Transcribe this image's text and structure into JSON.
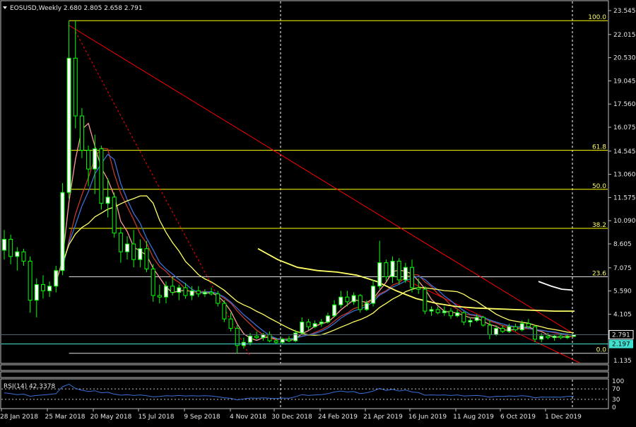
{
  "window": {
    "symbol_line": "EOSUSD,Weekly  2.680 2.805 2.658 2.791",
    "menu_icon": "triangle-down-icon"
  },
  "colors": {
    "background": "#000000",
    "bull_candle": "#ffffff",
    "bear_candle": "#ffffff",
    "candle_outline": "#00ff00",
    "fib_line": "#ffff00",
    "trend_line": "#ff0000",
    "ma_fast": "#ff9999",
    "ma_mid": "#c0392b",
    "ma_blue": "#3a6fd8",
    "ma_yellow": "#ffff66",
    "ma_white": "#ffffff",
    "current_price_box": "#ffffff",
    "bid_box": "#40e0d0",
    "rsi_line": "#3a6fd8"
  },
  "chart_data": {
    "type": "candlestick",
    "title": "EOSUSD,Weekly",
    "ohlc_label": "2.680 2.805 2.658 2.791",
    "ylim": [
      1.135,
      23.545
    ],
    "y_ticks": [
      "23.545",
      "22.015",
      "20.530",
      "19.045",
      "17.560",
      "16.075",
      "14.545",
      "13.060",
      "11.575",
      "10.090",
      "8.605",
      "7.075",
      "5.590",
      "4.105",
      "2.791",
      "2.197",
      "1.135"
    ],
    "x_tick_labels": [
      "28 Jan 2018",
      "25 Mar 2018",
      "20 May 2018",
      "15 Jul 2018",
      "9 Sep 2018",
      "4 Nov 2018",
      "30 Dec 2018",
      "24 Feb 2019",
      "21 Apr 2019",
      "16 Jun 2019",
      "11 Aug 2019",
      "6 Oct 2019",
      "1 Dec 2019"
    ],
    "fib_levels": [
      {
        "label": "100.0",
        "value": 22.9
      },
      {
        "label": "61.8",
        "value": 14.6
      },
      {
        "label": "50.0",
        "value": 12.1
      },
      {
        "label": "38.2",
        "value": 9.6
      },
      {
        "label": "23.6",
        "value": 6.5
      },
      {
        "label": "0.0",
        "value": 1.6
      }
    ],
    "current_price": "2.791",
    "bid_price": "2.197",
    "candles": [
      {
        "o": 8.2,
        "h": 9.5,
        "l": 7.6,
        "c": 8.9
      },
      {
        "o": 8.9,
        "h": 9.2,
        "l": 7.3,
        "c": 7.8
      },
      {
        "o": 7.8,
        "h": 8.4,
        "l": 6.9,
        "c": 8.1
      },
      {
        "o": 8.1,
        "h": 8.3,
        "l": 7.2,
        "c": 7.5
      },
      {
        "o": 7.5,
        "h": 7.8,
        "l": 4.2,
        "c": 5.0
      },
      {
        "o": 5.0,
        "h": 6.4,
        "l": 3.9,
        "c": 6.0
      },
      {
        "o": 6.0,
        "h": 6.6,
        "l": 5.1,
        "c": 5.6
      },
      {
        "o": 5.6,
        "h": 6.2,
        "l": 5.2,
        "c": 5.9
      },
      {
        "o": 5.9,
        "h": 7.2,
        "l": 5.5,
        "c": 6.9
      },
      {
        "o": 6.9,
        "h": 12.5,
        "l": 6.6,
        "c": 11.9
      },
      {
        "o": 11.9,
        "h": 22.9,
        "l": 11.5,
        "c": 20.5
      },
      {
        "o": 20.5,
        "h": 22.9,
        "l": 16.0,
        "c": 16.8
      },
      {
        "o": 16.8,
        "h": 17.3,
        "l": 14.1,
        "c": 14.6
      },
      {
        "o": 14.6,
        "h": 14.9,
        "l": 12.3,
        "c": 13.4
      },
      {
        "o": 13.4,
        "h": 15.6,
        "l": 11.8,
        "c": 14.7
      },
      {
        "o": 14.7,
        "h": 14.9,
        "l": 10.8,
        "c": 11.2
      },
      {
        "o": 11.2,
        "h": 12.8,
        "l": 10.3,
        "c": 11.6
      },
      {
        "o": 11.6,
        "h": 11.9,
        "l": 9.0,
        "c": 9.3
      },
      {
        "o": 9.3,
        "h": 9.7,
        "l": 7.4,
        "c": 8.1
      },
      {
        "o": 8.1,
        "h": 9.1,
        "l": 7.6,
        "c": 8.6
      },
      {
        "o": 8.6,
        "h": 9.5,
        "l": 7.1,
        "c": 7.6
      },
      {
        "o": 7.6,
        "h": 8.9,
        "l": 7.1,
        "c": 8.3
      },
      {
        "o": 8.3,
        "h": 8.8,
        "l": 6.8,
        "c": 7.0
      },
      {
        "o": 7.0,
        "h": 7.3,
        "l": 4.9,
        "c": 5.3
      },
      {
        "o": 5.3,
        "h": 6.0,
        "l": 4.8,
        "c": 5.2
      },
      {
        "o": 5.2,
        "h": 6.2,
        "l": 4.8,
        "c": 5.9
      },
      {
        "o": 5.9,
        "h": 6.5,
        "l": 5.3,
        "c": 5.5
      },
      {
        "o": 5.5,
        "h": 6.0,
        "l": 5.0,
        "c": 5.8
      },
      {
        "o": 5.8,
        "h": 6.1,
        "l": 5.1,
        "c": 5.3
      },
      {
        "o": 5.3,
        "h": 5.9,
        "l": 5.0,
        "c": 5.6
      },
      {
        "o": 5.6,
        "h": 5.9,
        "l": 5.2,
        "c": 5.4
      },
      {
        "o": 5.4,
        "h": 5.7,
        "l": 5.2,
        "c": 5.5
      },
      {
        "o": 5.5,
        "h": 5.8,
        "l": 5.3,
        "c": 5.4
      },
      {
        "o": 5.4,
        "h": 5.6,
        "l": 4.6,
        "c": 4.8
      },
      {
        "o": 4.8,
        "h": 5.0,
        "l": 3.6,
        "c": 3.8
      },
      {
        "o": 3.8,
        "h": 4.2,
        "l": 3.0,
        "c": 3.2
      },
      {
        "o": 3.2,
        "h": 3.4,
        "l": 1.6,
        "c": 2.1
      },
      {
        "o": 2.1,
        "h": 2.6,
        "l": 1.9,
        "c": 2.3
      },
      {
        "o": 2.3,
        "h": 2.9,
        "l": 2.1,
        "c": 2.7
      },
      {
        "o": 2.7,
        "h": 3.0,
        "l": 2.5,
        "c": 2.6
      },
      {
        "o": 2.6,
        "h": 2.9,
        "l": 2.4,
        "c": 2.8
      },
      {
        "o": 2.8,
        "h": 3.0,
        "l": 2.3,
        "c": 2.4
      },
      {
        "o": 2.4,
        "h": 2.6,
        "l": 2.2,
        "c": 2.3
      },
      {
        "o": 2.3,
        "h": 2.6,
        "l": 2.2,
        "c": 2.5
      },
      {
        "o": 2.5,
        "h": 2.7,
        "l": 2.3,
        "c": 2.4
      },
      {
        "o": 2.4,
        "h": 3.1,
        "l": 2.3,
        "c": 2.9
      },
      {
        "o": 2.9,
        "h": 3.9,
        "l": 2.8,
        "c": 3.6
      },
      {
        "o": 3.6,
        "h": 3.8,
        "l": 3.1,
        "c": 3.3
      },
      {
        "o": 3.3,
        "h": 3.7,
        "l": 3.2,
        "c": 3.5
      },
      {
        "o": 3.5,
        "h": 3.8,
        "l": 3.3,
        "c": 3.6
      },
      {
        "o": 3.6,
        "h": 4.2,
        "l": 3.5,
        "c": 4.0
      },
      {
        "o": 4.0,
        "h": 5.0,
        "l": 3.9,
        "c": 4.7
      },
      {
        "o": 4.7,
        "h": 5.6,
        "l": 4.5,
        "c": 5.2
      },
      {
        "o": 5.2,
        "h": 5.6,
        "l": 4.6,
        "c": 4.9
      },
      {
        "o": 4.9,
        "h": 5.5,
        "l": 4.7,
        "c": 5.3
      },
      {
        "o": 5.3,
        "h": 5.4,
        "l": 4.2,
        "c": 4.4
      },
      {
        "o": 4.4,
        "h": 5.0,
        "l": 4.3,
        "c": 4.8
      },
      {
        "o": 4.8,
        "h": 6.3,
        "l": 4.6,
        "c": 5.9
      },
      {
        "o": 5.9,
        "h": 8.8,
        "l": 5.7,
        "c": 7.4
      },
      {
        "o": 7.4,
        "h": 7.6,
        "l": 6.2,
        "c": 6.5
      },
      {
        "o": 6.5,
        "h": 7.8,
        "l": 6.1,
        "c": 7.5
      },
      {
        "o": 7.5,
        "h": 7.7,
        "l": 6.0,
        "c": 6.3
      },
      {
        "o": 6.3,
        "h": 7.4,
        "l": 6.1,
        "c": 7.1
      },
      {
        "o": 7.1,
        "h": 7.6,
        "l": 5.5,
        "c": 5.8
      },
      {
        "o": 5.8,
        "h": 6.4,
        "l": 5.4,
        "c": 5.7
      },
      {
        "o": 5.7,
        "h": 5.9,
        "l": 4.1,
        "c": 4.3
      },
      {
        "o": 4.3,
        "h": 4.6,
        "l": 4.0,
        "c": 4.4
      },
      {
        "o": 4.4,
        "h": 4.6,
        "l": 4.1,
        "c": 4.2
      },
      {
        "o": 4.2,
        "h": 4.6,
        "l": 4.0,
        "c": 4.3
      },
      {
        "o": 4.3,
        "h": 4.5,
        "l": 3.8,
        "c": 4.0
      },
      {
        "o": 4.0,
        "h": 4.4,
        "l": 3.9,
        "c": 4.2
      },
      {
        "o": 4.2,
        "h": 4.3,
        "l": 3.4,
        "c": 3.6
      },
      {
        "o": 3.6,
        "h": 3.9,
        "l": 3.3,
        "c": 3.7
      },
      {
        "o": 3.7,
        "h": 4.1,
        "l": 3.6,
        "c": 3.9
      },
      {
        "o": 3.9,
        "h": 4.0,
        "l": 3.3,
        "c": 3.4
      },
      {
        "o": 3.4,
        "h": 3.7,
        "l": 2.5,
        "c": 2.8
      },
      {
        "o": 2.8,
        "h": 3.4,
        "l": 2.7,
        "c": 3.2
      },
      {
        "o": 3.2,
        "h": 3.4,
        "l": 2.9,
        "c": 3.0
      },
      {
        "o": 3.0,
        "h": 3.5,
        "l": 2.9,
        "c": 3.3
      },
      {
        "o": 3.3,
        "h": 3.5,
        "l": 3.0,
        "c": 3.1
      },
      {
        "o": 3.1,
        "h": 3.7,
        "l": 3.0,
        "c": 3.5
      },
      {
        "o": 3.5,
        "h": 3.8,
        "l": 3.2,
        "c": 3.3
      },
      {
        "o": 3.3,
        "h": 3.4,
        "l": 2.3,
        "c": 2.5
      },
      {
        "o": 2.5,
        "h": 2.9,
        "l": 2.3,
        "c": 2.7
      },
      {
        "o": 2.7,
        "h": 2.9,
        "l": 2.5,
        "c": 2.6
      },
      {
        "o": 2.6,
        "h": 2.8,
        "l": 2.4,
        "c": 2.7
      },
      {
        "o": 2.7,
        "h": 2.9,
        "l": 2.5,
        "c": 2.6
      },
      {
        "o": 2.6,
        "h": 2.8,
        "l": 2.5,
        "c": 2.68
      },
      {
        "o": 2.68,
        "h": 2.805,
        "l": 2.658,
        "c": 2.791
      }
    ]
  },
  "rsi": {
    "label": "RSI(14) 42.3378",
    "levels": [
      "100",
      "70",
      "30",
      "0"
    ],
    "values": [
      55,
      52,
      48,
      50,
      42,
      45,
      47,
      49,
      52,
      78,
      88,
      72,
      65,
      60,
      63,
      55,
      57,
      50,
      46,
      48,
      45,
      47,
      44,
      40,
      41,
      44,
      43,
      45,
      43,
      44,
      43,
      44,
      43,
      40,
      36,
      34,
      28,
      32,
      35,
      34,
      36,
      34,
      33,
      35,
      34,
      40,
      48,
      45,
      47,
      48,
      52,
      58,
      62,
      58,
      60,
      52,
      55,
      62,
      72,
      64,
      68,
      62,
      66,
      58,
      56,
      46,
      47,
      46,
      47,
      45,
      47,
      43,
      44,
      45,
      43,
      38,
      42,
      41,
      43,
      42,
      44,
      42,
      36,
      39,
      38,
      39,
      38,
      41,
      42
    ]
  }
}
